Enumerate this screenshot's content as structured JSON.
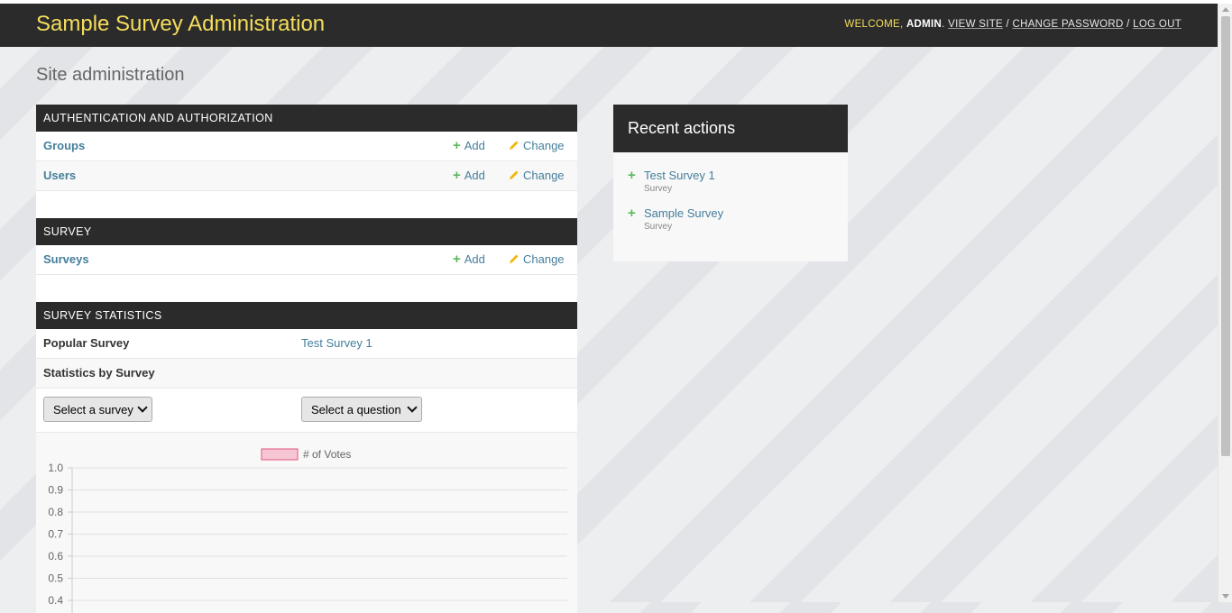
{
  "header": {
    "site_title": "Sample Survey Administration",
    "welcome": "Welcome,",
    "username": "admin",
    "view_site": "View site",
    "change_password": "Change password",
    "log_out": "Log out"
  },
  "page_title": "Site administration",
  "modules": {
    "auth": {
      "caption": "Authentication and Authorization",
      "models": [
        {
          "name": "Groups",
          "add": "Add",
          "change": "Change"
        },
        {
          "name": "Users",
          "add": "Add",
          "change": "Change"
        }
      ]
    },
    "survey": {
      "caption": "Survey",
      "models": [
        {
          "name": "Surveys",
          "add": "Add",
          "change": "Change"
        }
      ]
    },
    "stats": {
      "caption": "Survey Statistics",
      "popular_label": "Popular Survey",
      "popular_value": "Test Survey 1",
      "by_survey_label": "Statistics by Survey",
      "select_survey": "Select a survey",
      "select_question": "Select a question"
    }
  },
  "recent_actions": {
    "title": "Recent actions",
    "items": [
      {
        "name": "Test Survey 1",
        "type": "Survey",
        "icon": "plus-icon"
      },
      {
        "name": "Sample Survey",
        "type": "Survey",
        "icon": "plus-icon"
      }
    ]
  },
  "colors": {
    "header_bg": "#2b2b2b",
    "brand_yellow": "#f5dd5d",
    "link_blue": "#447e9b",
    "add_green": "#5cb85c",
    "change_yellow": "#efb80b",
    "legend_fill": "#f7c6d4",
    "legend_border": "#e0557d"
  },
  "chart_data": {
    "type": "bar",
    "legend": [
      "# of Votes"
    ],
    "yticks_visible": [
      "1.0",
      "0.9",
      "0.8",
      "0.7",
      "0.6",
      "0.5",
      "0.4"
    ],
    "ylim": [
      0,
      1.0
    ],
    "categories": [],
    "series": [
      {
        "name": "# of Votes",
        "values": []
      }
    ],
    "grid": true,
    "legend_position": "top"
  }
}
